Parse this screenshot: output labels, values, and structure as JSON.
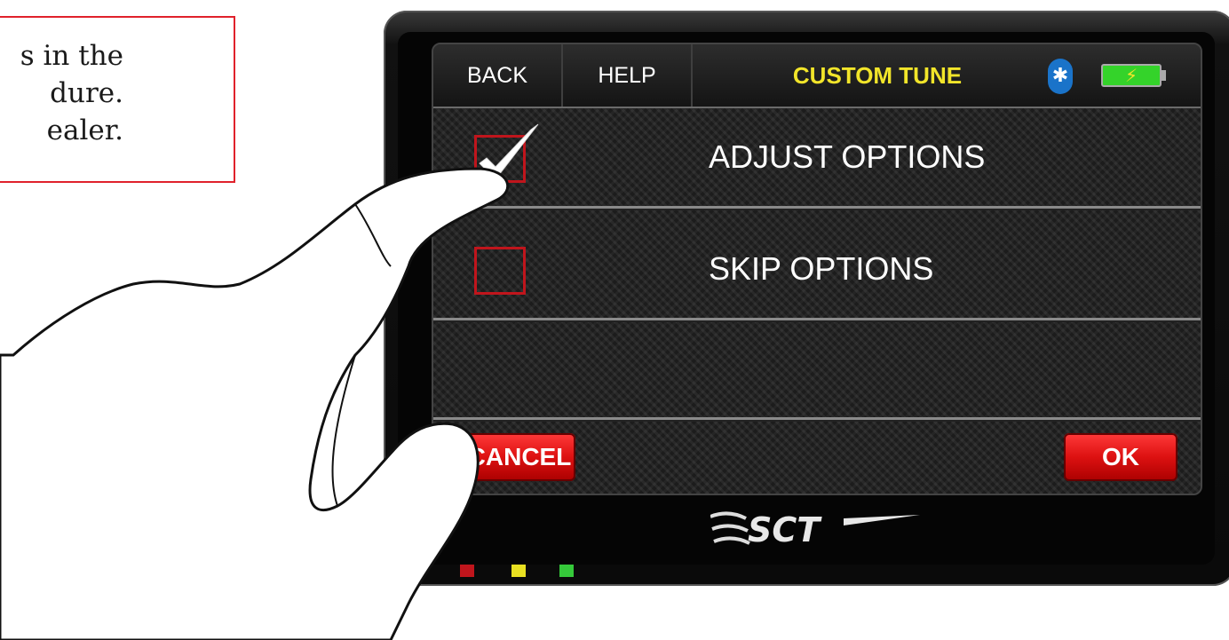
{
  "note": {
    "lines": [
      "s in the",
      "dure.",
      "ealer."
    ]
  },
  "device": {
    "topbar": {
      "back_label": "BACK",
      "help_label": "HELP",
      "title": "CUSTOM TUNE",
      "bluetooth_icon": "bluetooth-icon",
      "battery_icon": "battery-charging-icon"
    },
    "options": [
      {
        "label": "ADJUST OPTIONS",
        "checked": true
      },
      {
        "label": "SKIP OPTIONS",
        "checked": false
      }
    ],
    "cancel_label": "CANCEL",
    "ok_label": "OK",
    "brand": "SCT",
    "leds": [
      "red",
      "yellow",
      "green"
    ]
  },
  "colors": {
    "accent_red": "#c0151c",
    "title_yellow": "#f2e52a",
    "battery_green": "#34d32a",
    "bluetooth_blue": "#1a73c9"
  }
}
